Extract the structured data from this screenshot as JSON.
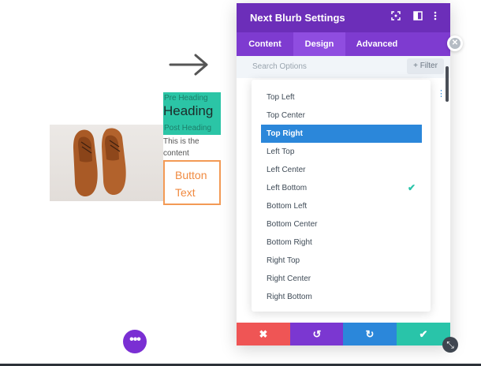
{
  "preview": {
    "pre_heading": "Pre Heading",
    "heading": "Heading",
    "post_heading": "Post Heading",
    "content_line1": "This is the",
    "content_line2": "content",
    "button_line1": "Button",
    "button_line2": "Text",
    "fab_label": "•••"
  },
  "modal": {
    "title": "Next Blurb Settings",
    "tabs": [
      "Content",
      "Design",
      "Advanced"
    ],
    "active_tab": "Design",
    "search_placeholder": "Search Options",
    "filter_label": "+ Filter",
    "dropdown_options": [
      "Top Left",
      "Top Center",
      "Top Right",
      "Left Top",
      "Left Center",
      "Left Bottom",
      "Bottom Left",
      "Bottom Center",
      "Bottom Right",
      "Right Top",
      "Right Center",
      "Right Bottom"
    ],
    "highlighted_option": "Top Right",
    "checked_option": "Left Bottom",
    "footer": {
      "cancel_icon": "✖",
      "undo_icon": "↺",
      "redo_icon": "↻",
      "save_icon": "✔"
    }
  },
  "icons": {
    "header": [
      "focus-icon",
      "split-view-icon",
      "more-vert-icon"
    ],
    "close": "close-icon",
    "resize": "resize-icon",
    "arrow": "arrow-right-icon"
  },
  "colors": {
    "header": "#6c2eb9",
    "tabs": "#7e3bd0",
    "selected": "#2b87da",
    "check": "#29c4a9",
    "cancel": "#ef5555",
    "undo": "#7b37d1",
    "redo": "#2b87da",
    "save": "#29c4a9",
    "teal_box": "#2bc5a6",
    "button_border": "#f39a55"
  }
}
